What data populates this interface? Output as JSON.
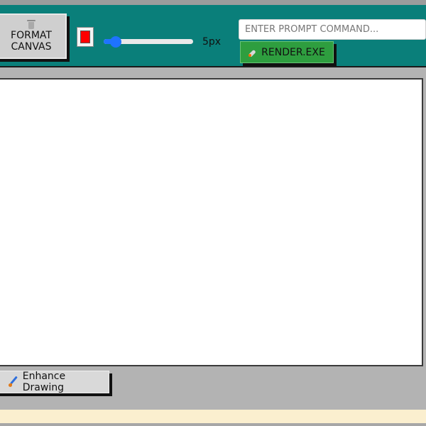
{
  "toolbar": {
    "format_button": {
      "icon": "trash-icon",
      "line1": "FORMAT",
      "line2": "CANVAS"
    },
    "brush_color": "#ff0000",
    "brush_size": {
      "value": 5,
      "min": 1,
      "max": 50,
      "label": "5px"
    },
    "prompt": {
      "placeholder": "ENTER PROMPT COMMAND...",
      "value": ""
    },
    "render_button": {
      "icon": "rocket-icon",
      "label": "RENDER.EXE"
    }
  },
  "actions": {
    "enhance_button": {
      "icon": "paintbrush-icon",
      "label": "Enhance Drawing"
    }
  },
  "colors": {
    "toolbar_bg": "#0a7f7a",
    "render_button": "#2e9e3f",
    "canvas_bg": "#ffffff",
    "app_bg": "#b3b3b3",
    "status_bar": "#fbefcf",
    "slider_accent": "#1e73ff"
  }
}
